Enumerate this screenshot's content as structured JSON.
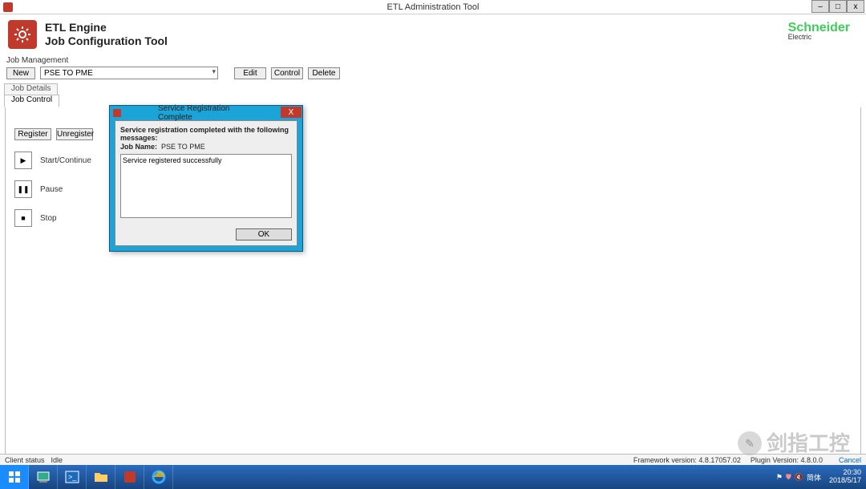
{
  "window": {
    "title": "ETL Administration Tool"
  },
  "header": {
    "title1": "ETL Engine",
    "title2": "Job Configuration Tool",
    "brand": "Schneider",
    "brand_sub": "Electric"
  },
  "job_mgmt": {
    "label": "Job Management",
    "new_btn": "New",
    "combo_value": "PSE TO PME",
    "edit_btn": "Edit",
    "control_btn": "Control",
    "delete_btn": "Delete"
  },
  "tabs": {
    "details": "Job Details",
    "control": "Job Control"
  },
  "job_control": {
    "register": "Register",
    "unregister": "Unregister",
    "start_continue": "Start/Continue",
    "pause": "Pause",
    "stop": "Stop"
  },
  "dialog": {
    "title": "Service Registration Complete",
    "message": "Service registration completed with the following messages:",
    "job_name_label": "Job Name:",
    "job_name_value": "PSE TO PME",
    "log": "Service registered successfully",
    "ok": "OK"
  },
  "status": {
    "client_label": "Client status",
    "client_value": "Idle",
    "framework": "Framework version: 4.8.17057.02",
    "plugin": "Plugin Version: 4.8.0.0",
    "cancel": "Cancel"
  },
  "tray": {
    "lang": "简体",
    "time": "20:30",
    "date": "2018/5/17"
  },
  "watermark": "剑指工控"
}
